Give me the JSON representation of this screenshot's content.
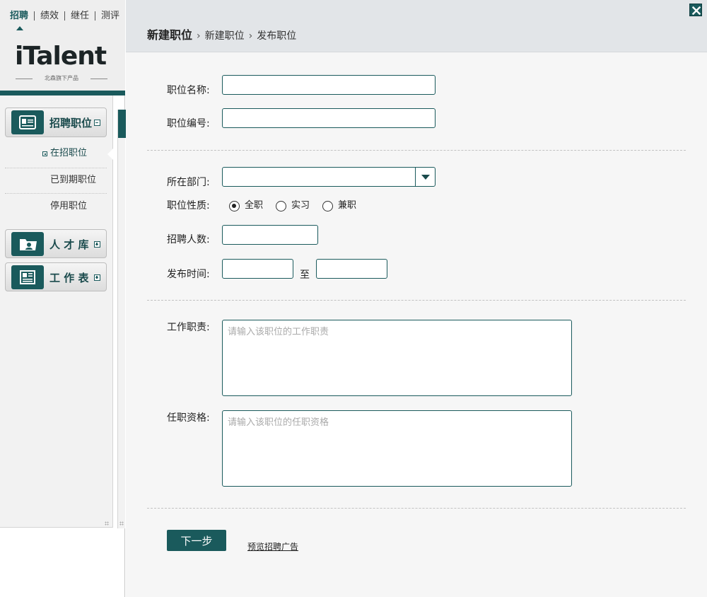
{
  "topnav": {
    "items": [
      "招聘",
      "绩效",
      "继任",
      "测评"
    ],
    "active_index": 0
  },
  "logo": {
    "brand": "iTalent",
    "tagline": "北森旗下产品"
  },
  "sidebar": {
    "sections": [
      {
        "label": "招聘职位",
        "icon": "id-card-icon",
        "expanded": true
      },
      {
        "label": "人 才 库",
        "icon": "folder-person-icon",
        "expanded": false
      },
      {
        "label": "工 作 表",
        "icon": "worksheet-icon",
        "expanded": false
      }
    ],
    "sub_items": [
      "在招职位",
      "已到期职位",
      "停用职位"
    ],
    "active_sub_index": 0
  },
  "header": {
    "breadcrumb_main": "新建职位",
    "breadcrumb_1": "新建职位",
    "breadcrumb_2": "发布职位",
    "close_icon": "close-icon"
  },
  "form": {
    "position_name_label": "职位名称:",
    "position_name_value": "",
    "position_code_label": "职位编号:",
    "position_code_value": "",
    "department_label": "所在部门:",
    "department_value": "",
    "nature_label": "职位性质:",
    "nature_options": [
      "全职",
      "实习",
      "兼职"
    ],
    "nature_selected": "全职",
    "headcount_label": "招聘人数:",
    "headcount_value": "",
    "publish_time_label": "发布时间:",
    "publish_time_to": "至",
    "publish_start_value": "",
    "publish_end_value": "",
    "duties_label": "工作职责:",
    "duties_placeholder": "请输入该职位的工作职责",
    "qualifications_label": "任职资格:",
    "qualifications_placeholder": "请输入该职位的任职资格"
  },
  "actions": {
    "next_label": "下一步",
    "preview_label": "预览招聘广告"
  },
  "colors": {
    "brand_teal": "#1a5a5c",
    "header_bg": "#e2e5e8",
    "panel_bg": "#f6f6f6"
  }
}
